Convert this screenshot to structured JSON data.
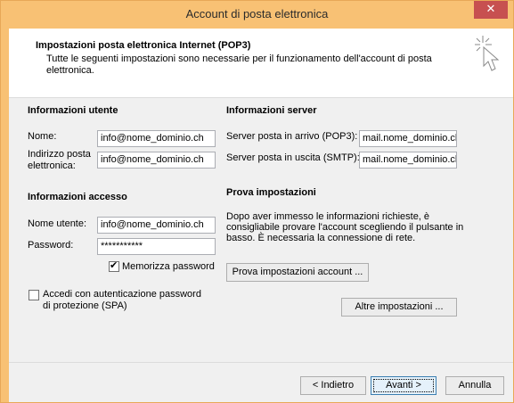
{
  "window": {
    "title": "Account di posta elettronica",
    "close_label": "✕"
  },
  "header": {
    "title": "Impostazioni posta elettronica Internet (POP3)",
    "description": "Tutte le seguenti impostazioni sono necessarie per il funzionamento dell'account di posta elettronica."
  },
  "user_info": {
    "section_title": "Informazioni utente",
    "name_label": "Nome:",
    "name_value": "info@nome_dominio.ch",
    "email_label_line1": "Indirizzo posta",
    "email_label_line2": "elettronica:",
    "email_value": "info@nome_dominio.ch"
  },
  "server_info": {
    "section_title": "Informazioni server",
    "incoming_label": "Server posta in arrivo (POP3):",
    "incoming_value": "mail.nome_dominio.ch",
    "outgoing_label": "Server posta in uscita (SMTP):",
    "outgoing_value": "mail.nome_dominio.ch"
  },
  "access_info": {
    "section_title": "Informazioni accesso",
    "username_label": "Nome utente:",
    "username_value": "info@nome_dominio.ch",
    "password_label": "Password:",
    "password_value": "***********",
    "remember_label": "Memorizza password",
    "remember_checked": true,
    "spa_label_line1": "Accedi con autenticazione password",
    "spa_label_line2": "di protezione (SPA)",
    "spa_checked": false
  },
  "test_settings": {
    "section_title": "Prova impostazioni",
    "description": "Dopo aver immesso le informazioni richieste, è consigliabile provare l'account scegliendo il pulsante in basso. È necessaria la connessione di rete.",
    "test_button": "Prova impostazioni account ...",
    "more_button": "Altre impostazioni ..."
  },
  "footer": {
    "back_button": "< Indietro",
    "next_button": "Avanti >",
    "cancel_button": "Annulla"
  },
  "colors": {
    "title_bar": "#f8c174",
    "close_button": "#c75050"
  },
  "icons": {
    "wizard": "cursor-sparkle-icon"
  }
}
